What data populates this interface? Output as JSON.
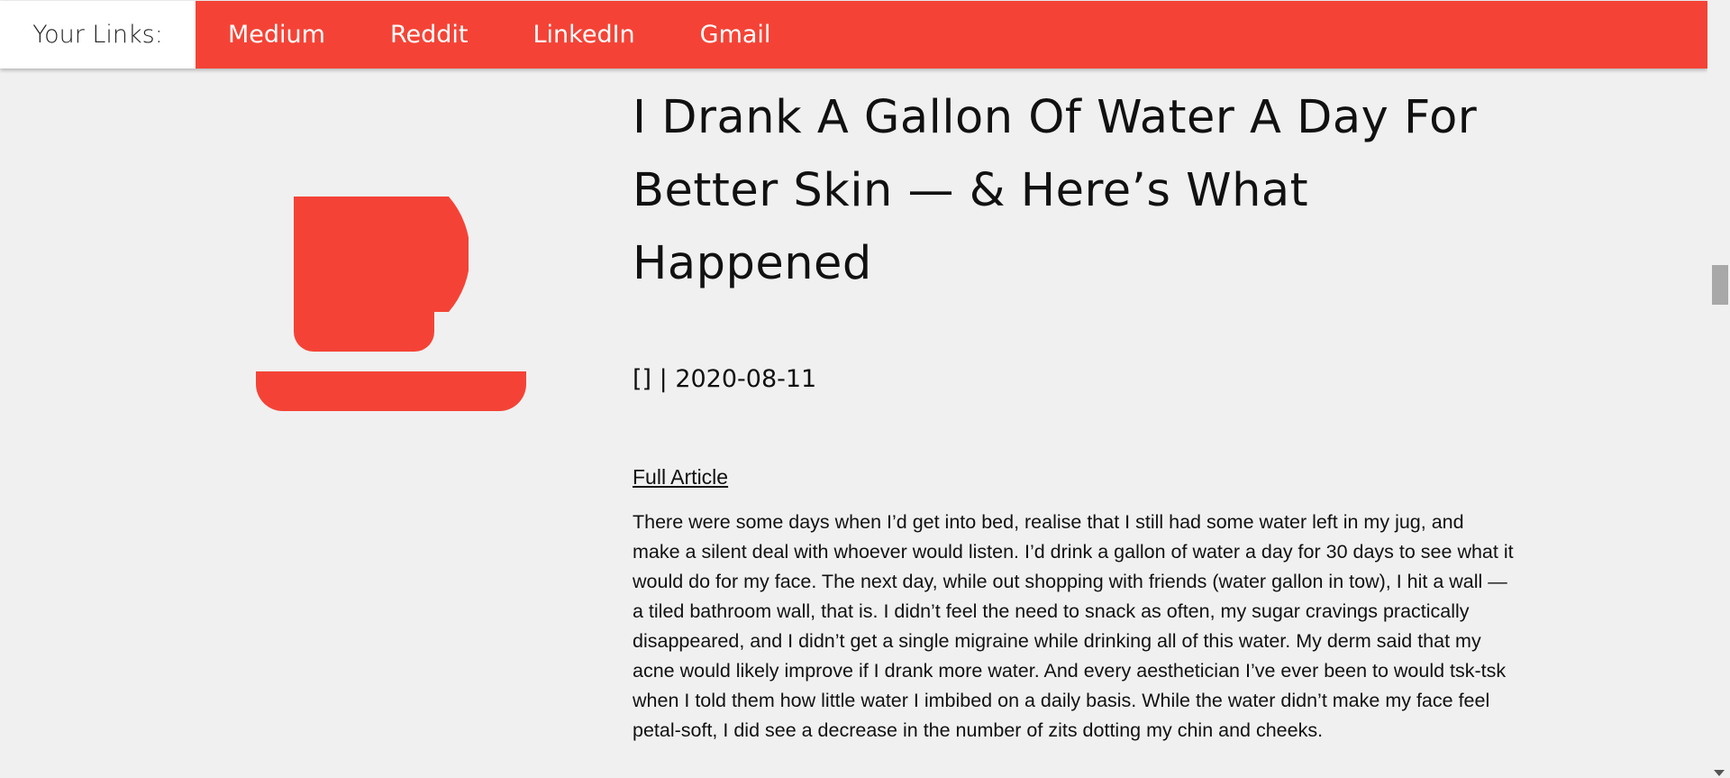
{
  "nav": {
    "label": "Your Links:",
    "links": [
      {
        "label": "Medium"
      },
      {
        "label": "Reddit"
      },
      {
        "label": "LinkedIn"
      },
      {
        "label": "Gmail"
      }
    ]
  },
  "hero": {
    "icon": "coffee-cup-icon",
    "color": "#f44336"
  },
  "article": {
    "title": "I Drank A Gallon Of Water A Day For Better Skin — & Here’s What Happened",
    "meta": "[] | 2020-08-11",
    "full_link": "Full Article",
    "body": "There were some days when I’d get into bed, realise that I still had some water left in my jug, and make a silent deal with whoever would listen. I’d drink a gallon of water a day for 30 days to see what it would do for my face. The next day, while out shopping with friends (water gallon in tow), I hit a wall — a tiled bathroom wall, that is. I didn’t feel the need to snack as often, my sugar cravings practically disappeared, and I didn’t get a single migraine while drinking all of this water. My derm said that my acne would likely improve if I drank more water. And every aesthetician I’ve ever been to would tsk-tsk when I told them how little water I imbibed on a daily basis. While the water didn’t make my face feel petal-soft, I did see a decrease in the number of zits dotting my chin and cheeks."
  },
  "colors": {
    "accent": "#f44336",
    "background": "#f0f0f0"
  }
}
